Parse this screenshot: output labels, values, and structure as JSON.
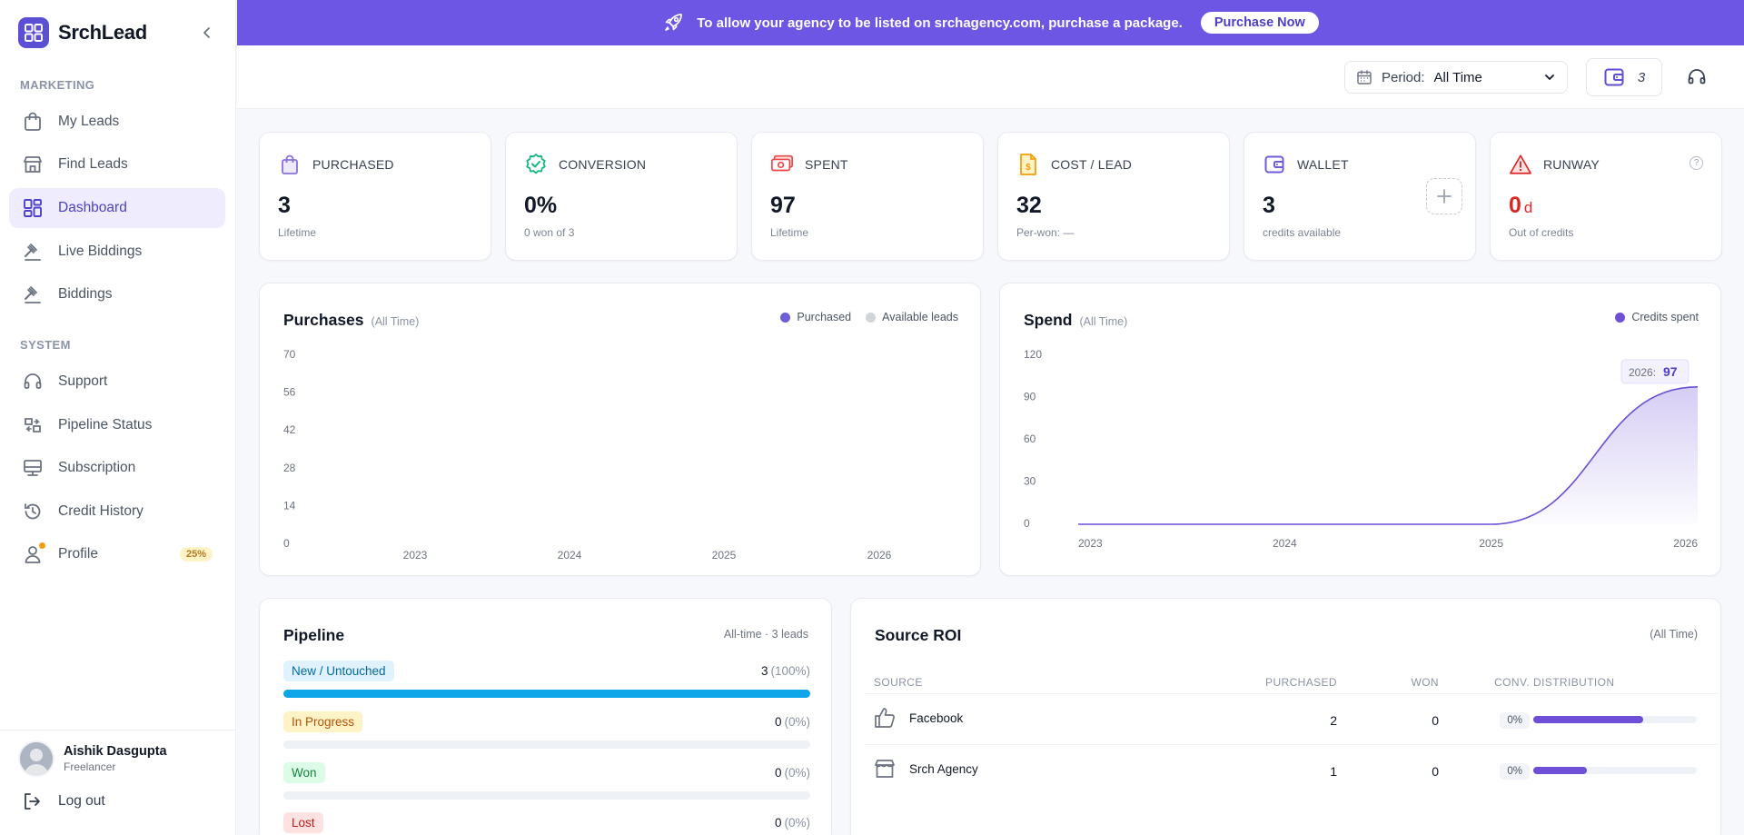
{
  "brand": {
    "name": "SrchLead"
  },
  "sidebar": {
    "sections": {
      "marketing": "MARKETING",
      "system": "SYSTEM"
    },
    "items": [
      {
        "label": "My Leads",
        "icon": "shopping-bag-icon"
      },
      {
        "label": "Find Leads",
        "icon": "storefront-icon"
      },
      {
        "label": "Dashboard",
        "icon": "dashboard-grid-icon",
        "active": true
      },
      {
        "label": "Live Biddings",
        "icon": "gavel-icon"
      },
      {
        "label": "Biddings",
        "icon": "gavel-icon"
      },
      {
        "label": "Support",
        "icon": "headset-icon"
      },
      {
        "label": "Pipeline Status",
        "icon": "pipeline-icon"
      },
      {
        "label": "Subscription",
        "icon": "subscription-icon"
      },
      {
        "label": "Credit History",
        "icon": "history-icon"
      },
      {
        "label": "Profile",
        "icon": "user-icon",
        "badge": "25%"
      }
    ],
    "user": {
      "name": "Aishik Dasgupta",
      "role": "Freelancer"
    },
    "logout": "Log out"
  },
  "banner": {
    "text": "To allow your agency to be listed on srchagency.com, purchase a package.",
    "button": "Purchase Now",
    "color": "#6c56e3"
  },
  "toolbar": {
    "period_label": "Period:",
    "period_value": "All Time",
    "wallet_count": "3"
  },
  "kpis": [
    {
      "label": "PURCHASED",
      "value": "3",
      "sub": "Lifetime",
      "icon": "shopping-bag-icon",
      "color": "#8b6fe0"
    },
    {
      "label": "CONVERSION",
      "value": "0%",
      "sub": "0 won of 3",
      "icon": "verified-badge-icon",
      "color": "#10b981"
    },
    {
      "label": "SPENT",
      "value": "97",
      "sub": "Lifetime",
      "icon": "money-icon",
      "color": "#ef4444"
    },
    {
      "label": "COST / LEAD",
      "value": "32",
      "sub": "Per-won: —",
      "icon": "invoice-dollar-icon",
      "color": "#f59e0b"
    },
    {
      "label": "WALLET",
      "value": "3",
      "sub": "credits available",
      "icon": "wallet-icon",
      "color": "#6d5ed8"
    },
    {
      "label": "RUNWAY",
      "value": "0",
      "unit": "d",
      "sub": "Out of credits",
      "icon": "warning-triangle-icon",
      "color": "#dc2626"
    }
  ],
  "purchases": {
    "title": "Purchases",
    "period": "(All Time)",
    "legend": [
      {
        "name": "Purchased",
        "color": "#6d5ed8"
      },
      {
        "name": "Available leads",
        "color": "#d1d5db"
      }
    ]
  },
  "spend": {
    "title": "Spend",
    "period": "(All Time)",
    "legend": [
      {
        "name": "Credits spent",
        "color": "#6d4fd8"
      }
    ],
    "tooltip_year": "2026:",
    "tooltip_value": "97"
  },
  "pipeline": {
    "title": "Pipeline",
    "meta": "All-time · 3 leads",
    "rows": [
      {
        "label": "New / Untouched",
        "count": "3",
        "pct": "(100%)",
        "fraction": 1.0,
        "bg": "#e0f2fe",
        "fg": "#0369a1"
      },
      {
        "label": "In Progress",
        "count": "0",
        "pct": "(0%)",
        "fraction": 0,
        "bg": "#fef3c7",
        "fg": "#b45309"
      },
      {
        "label": "Won",
        "count": "0",
        "pct": "(0%)",
        "fraction": 0,
        "bg": "#dcfce7",
        "fg": "#15803d"
      },
      {
        "label": "Lost",
        "count": "0",
        "pct": "(0%)",
        "fraction": 0,
        "bg": "#fee2e2",
        "fg": "#b91c1c"
      }
    ]
  },
  "roi": {
    "title": "Source ROI",
    "meta": "(All Time)",
    "headers": {
      "source": "SOURCE",
      "purchased": "PURCHASED",
      "won": "WON",
      "conv": "CONV.",
      "distribution": "DISTRIBUTION"
    },
    "rows": [
      {
        "source": "Facebook",
        "icon": "thumbs-up-icon",
        "purchased": "2",
        "won": "0",
        "conv": "0%",
        "distribution": 0.67
      },
      {
        "source": "Srch Agency",
        "icon": "storefront-icon",
        "purchased": "1",
        "won": "0",
        "conv": "0%",
        "distribution": 0.33
      }
    ]
  },
  "chart_data": [
    {
      "type": "bar",
      "title": "Purchases",
      "categories": [
        "2023",
        "2024",
        "2025",
        "2026"
      ],
      "series": [
        {
          "name": "Purchased",
          "values": [
            0,
            0,
            0,
            0
          ]
        },
        {
          "name": "Available leads",
          "values": [
            0,
            0,
            0,
            0
          ]
        }
      ],
      "y_ticks": [
        "70",
        "56",
        "42",
        "28",
        "14",
        "0"
      ],
      "ylim": [
        0,
        70
      ],
      "legend": "top-right"
    },
    {
      "type": "area",
      "title": "Spend",
      "x": [
        "2023",
        "2024",
        "2025",
        "2026"
      ],
      "series": [
        {
          "name": "Credits spent",
          "values": [
            0,
            0,
            0,
            97
          ]
        }
      ],
      "y_ticks": [
        "120",
        "90",
        "60",
        "30",
        "0"
      ],
      "ylim": [
        0,
        120
      ],
      "legend": "top-right",
      "annotation": "2026: 97"
    }
  ]
}
